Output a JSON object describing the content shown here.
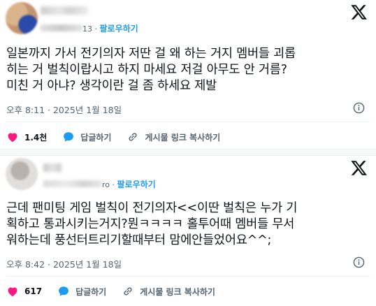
{
  "posts": [
    {
      "handle_tail": "13",
      "follow_label": "팔로우하기",
      "body": "일본까지 가서 전기의자 저딴 걸 왜 하는 거지 멤버들 괴롭\n히는 거 벌칙이랍시고 하지 마세요 저걸 아무도 안 거름?\n미친 거 아냐? 생각이란 걸 좀 하세요 제발",
      "timestamp": "오후 8:11 · 2025년 1월 18일",
      "likes": "1.4천",
      "reply_label": "답글하기",
      "copy_link_label": "게시물 링크 복사하기"
    },
    {
      "handle_tail": "ro",
      "follow_label": "팔로우하기",
      "body": "근데 팬미팅 게임 벌칙이 전기의자<<이딴 벌칙은 누가 기\n획하고 통과시키는거지?뭔ㅋㅋㅋㅋ 홀투어때 멤버들 무서\n워하는데 풍선터트리기할때부터 맘에안들었어요^^;",
      "timestamp": "오후 8:42 · 2025년 1월 18일",
      "likes": "617",
      "reply_label": "답글하기",
      "copy_link_label": "게시물 링크 복사하기"
    }
  ],
  "icons": {
    "logo": "x-logo-icon",
    "info": "info-icon",
    "like": "heart-icon",
    "reply": "speech-bubble-icon",
    "link": "link-icon"
  },
  "colors": {
    "like": "#f91880",
    "reply": "#1d9bf0",
    "follow": "#1d9bf0",
    "secondary_text": "#536471"
  }
}
